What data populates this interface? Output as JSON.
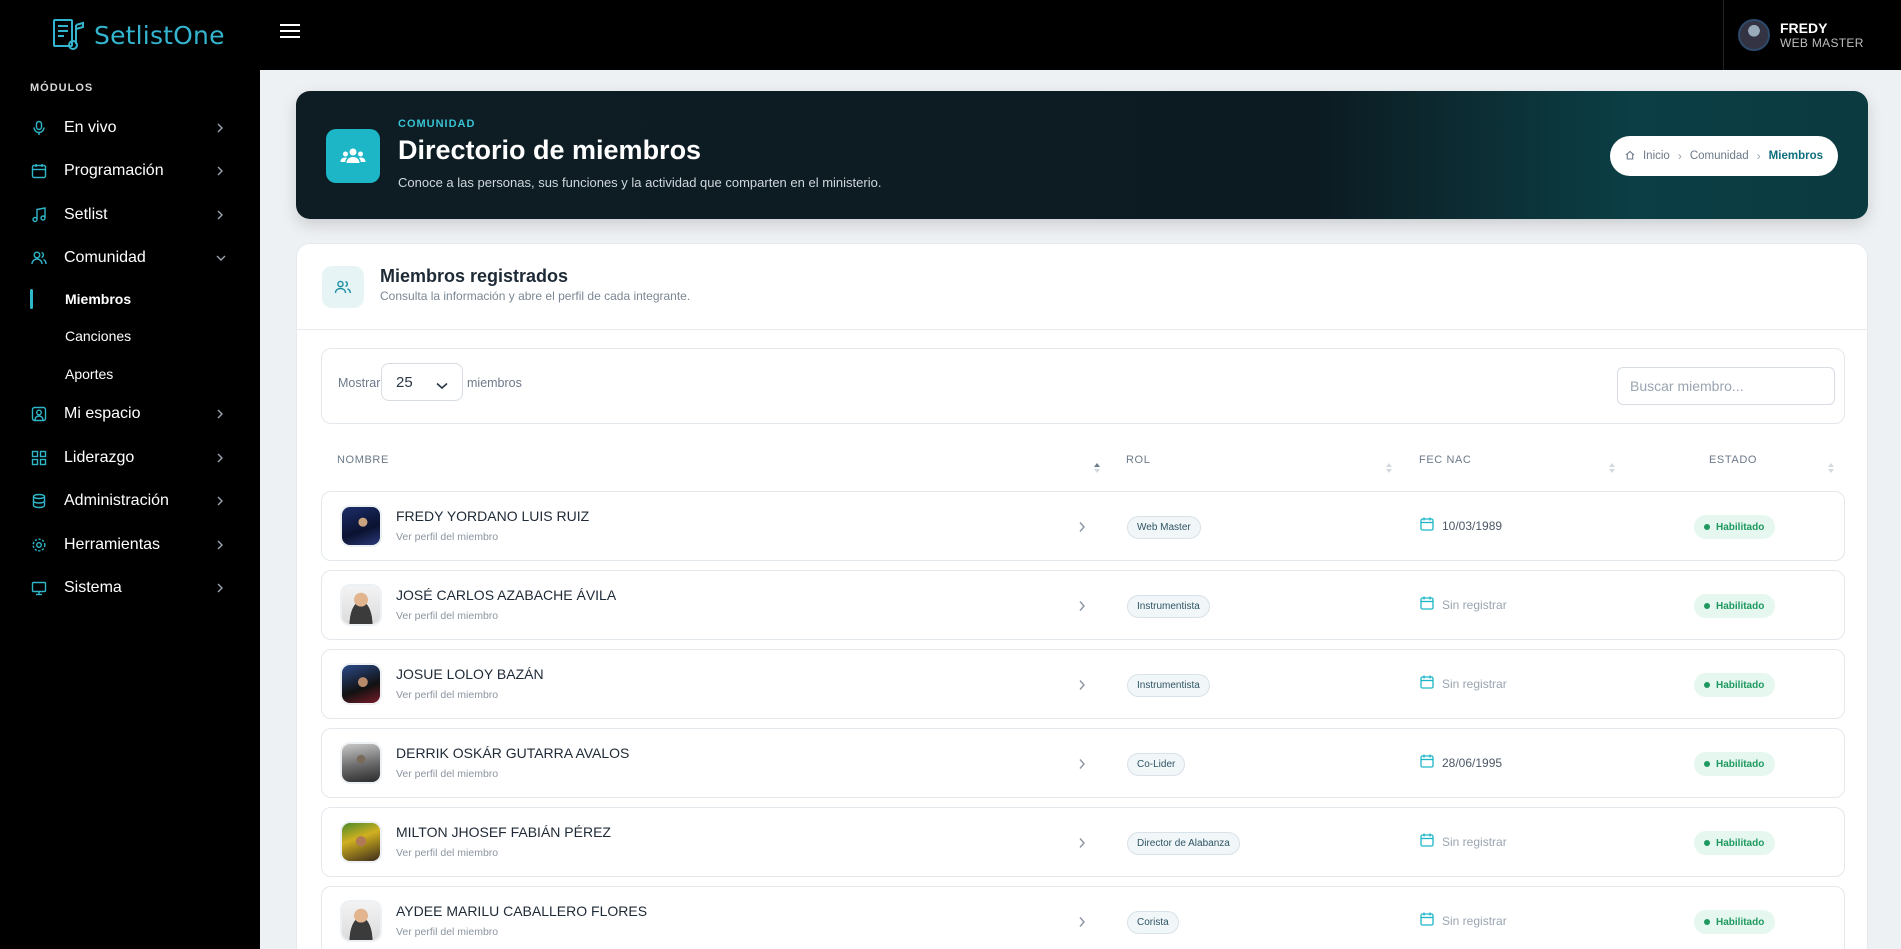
{
  "brand": {
    "name": "SetlistOne"
  },
  "sidebar": {
    "section_label": "MÓDULOS",
    "items": [
      {
        "label": "En vivo",
        "icon": "microphone-icon"
      },
      {
        "label": "Programación",
        "icon": "calendar-icon"
      },
      {
        "label": "Setlist",
        "icon": "music-note-icon"
      },
      {
        "label": "Comunidad",
        "icon": "users-icon",
        "expanded": true
      },
      {
        "label": "Mi espacio",
        "icon": "user-square-icon"
      },
      {
        "label": "Liderazgo",
        "icon": "grid-icon"
      },
      {
        "label": "Administración",
        "icon": "database-icon"
      },
      {
        "label": "Herramientas",
        "icon": "gear-icon"
      },
      {
        "label": "Sistema",
        "icon": "monitor-icon"
      }
    ],
    "community_sub": [
      {
        "label": "Miembros",
        "active": true
      },
      {
        "label": "Canciones"
      },
      {
        "label": "Aportes"
      }
    ]
  },
  "user": {
    "name": "FREDY",
    "role": "WEB MASTER"
  },
  "hero": {
    "eyebrow": "COMUNIDAD",
    "title": "Directorio de miembros",
    "subtitle": "Conoce a las personas, sus funciones y la actividad que comparten en el ministerio.",
    "breadcrumb": {
      "home": "Inicio",
      "section": "Comunidad",
      "current": "Miembros"
    }
  },
  "card": {
    "title": "Miembros registrados",
    "subtitle": "Consulta la información y abre el perfil de cada integrante.",
    "show_label": "Mostrar",
    "page_size": "25",
    "members_label": "miembros",
    "search_placeholder": "Buscar miembro..."
  },
  "table": {
    "columns": {
      "name": "NOMBRE",
      "role": "ROL",
      "dob": "FEC NAC",
      "status": "ESTADO"
    },
    "profile_link": "Ver perfil del miembro",
    "rows": [
      {
        "name": "FREDY YORDANO LUIS RUIZ",
        "role": "Web Master",
        "dob": "10/03/1989",
        "status": "Habilitado",
        "avatar": "photo-dark"
      },
      {
        "name": "JOSÉ CARLOS AZABACHE ÁVILA",
        "role": "Instrumentista",
        "dob": "Sin registrar",
        "status": "Habilitado",
        "avatar": "default"
      },
      {
        "name": "JOSUE LOLOY BAZÁN",
        "role": "Instrumentista",
        "dob": "Sin registrar",
        "status": "Habilitado",
        "avatar": "photo-blue"
      },
      {
        "name": "DERRIK OSKÁR GUTARRA AVALOS",
        "role": "Co-Lider",
        "dob": "28/06/1995",
        "status": "Habilitado",
        "avatar": "photo-gray"
      },
      {
        "name": "MILTON JHOSEF FABIÁN PÉREZ",
        "role": "Director de Alabanza",
        "dob": "Sin registrar",
        "status": "Habilitado",
        "avatar": "photo-green"
      },
      {
        "name": "AYDEE MARILU CABALLERO FLORES",
        "role": "Corista",
        "dob": "Sin registrar",
        "status": "Habilitado",
        "avatar": "default"
      }
    ]
  },
  "colors": {
    "accent": "#1db6c6",
    "status_green": "#1f9960",
    "sidebar_bg": "#000000"
  }
}
